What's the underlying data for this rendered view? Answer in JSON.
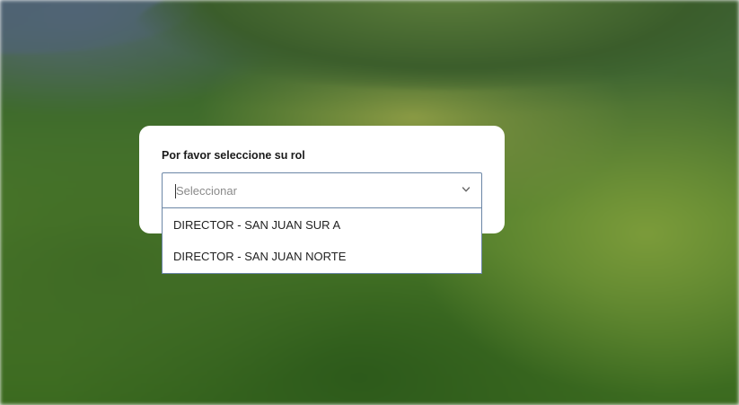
{
  "role_dialog": {
    "title": "Por favor seleccione su rol",
    "select": {
      "placeholder": "Seleccionar",
      "options": [
        "DIRECTOR - SAN JUAN SUR A",
        "DIRECTOR - SAN JUAN NORTE"
      ]
    }
  },
  "icons": {
    "chevron": "chevron-down-icon"
  }
}
